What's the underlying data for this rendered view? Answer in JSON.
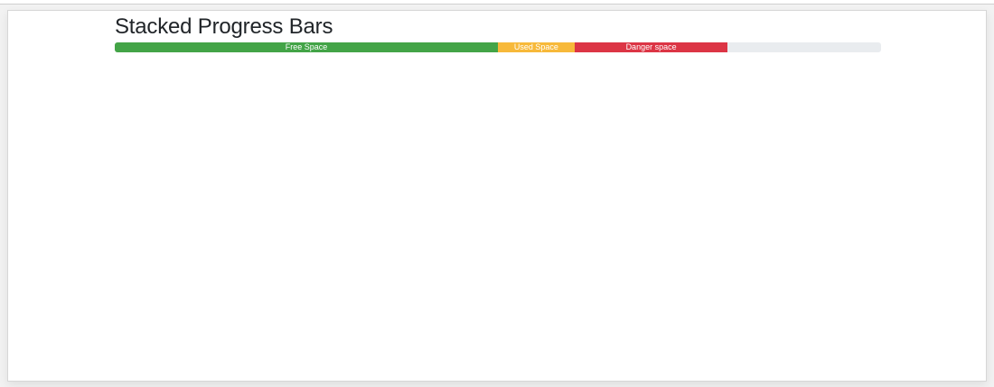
{
  "page": {
    "heading": "Stacked Progress Bars"
  },
  "progress_bar": {
    "track_color": "#e9ecef",
    "segments": [
      {
        "label": "Free Space",
        "percent": 50,
        "color": "#43a447"
      },
      {
        "label": "Used Space",
        "percent": 10,
        "color": "#f7b93a"
      },
      {
        "label": "Danger space",
        "percent": 20,
        "color": "#dc3545"
      }
    ]
  }
}
